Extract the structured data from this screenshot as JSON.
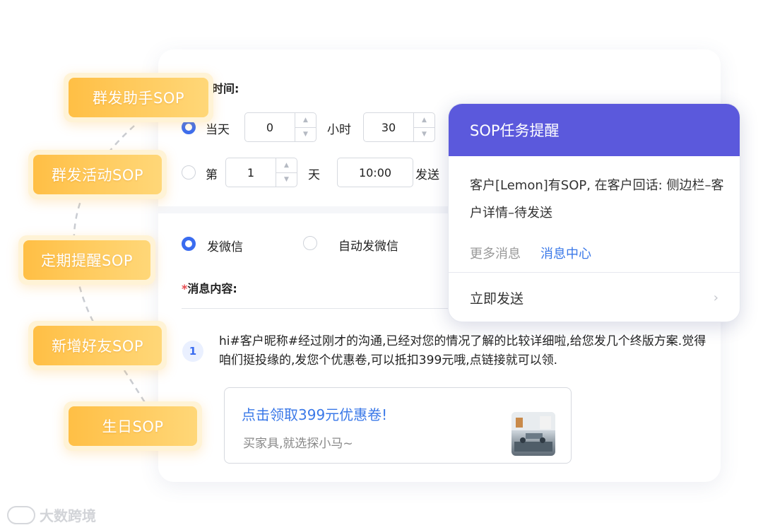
{
  "send_time": {
    "label": "时间:",
    "option1": {
      "label": "当天",
      "hours": "0",
      "hour_unit": "小时",
      "minutes": "30"
    },
    "option2": {
      "prefix": "第",
      "days": "1",
      "day_unit": "天",
      "time": "10:00",
      "suffix": "发送"
    }
  },
  "send_type": {
    "option1": "发微信",
    "option2": "自动发微信"
  },
  "message": {
    "label": "消息内容:",
    "required_mark": "*",
    "index": "1",
    "text": "hi#客户昵称#经过刚才的沟通,已经对您的情况了解的比较详细啦,给您发几个终版方案.觉得咱们挺投缘的,发您个优惠卷,可以抵扣399元哦,点链接就可以领."
  },
  "coupon": {
    "title": "点击领取399元优惠卷!",
    "subtitle": "买家具,就选探小马~"
  },
  "popup": {
    "title": "SOP任务提醒",
    "body": "客户[Lemon]有SOP, 在客户回话: 侧边栏–客户详情–待发送",
    "more": "更多消息",
    "center": "消息中心",
    "send_now": "立即发送"
  },
  "tags": [
    "群发助手SOP",
    "群发活动SOP",
    "定期提醒SOP",
    "新增好友SOP",
    "生日SOP"
  ],
  "watermark": "大数跨境",
  "colors": {
    "accent": "#3a6cf0",
    "popup_header": "#5b59dc",
    "tag": "#ffc24d",
    "link": "#3a78e8"
  }
}
